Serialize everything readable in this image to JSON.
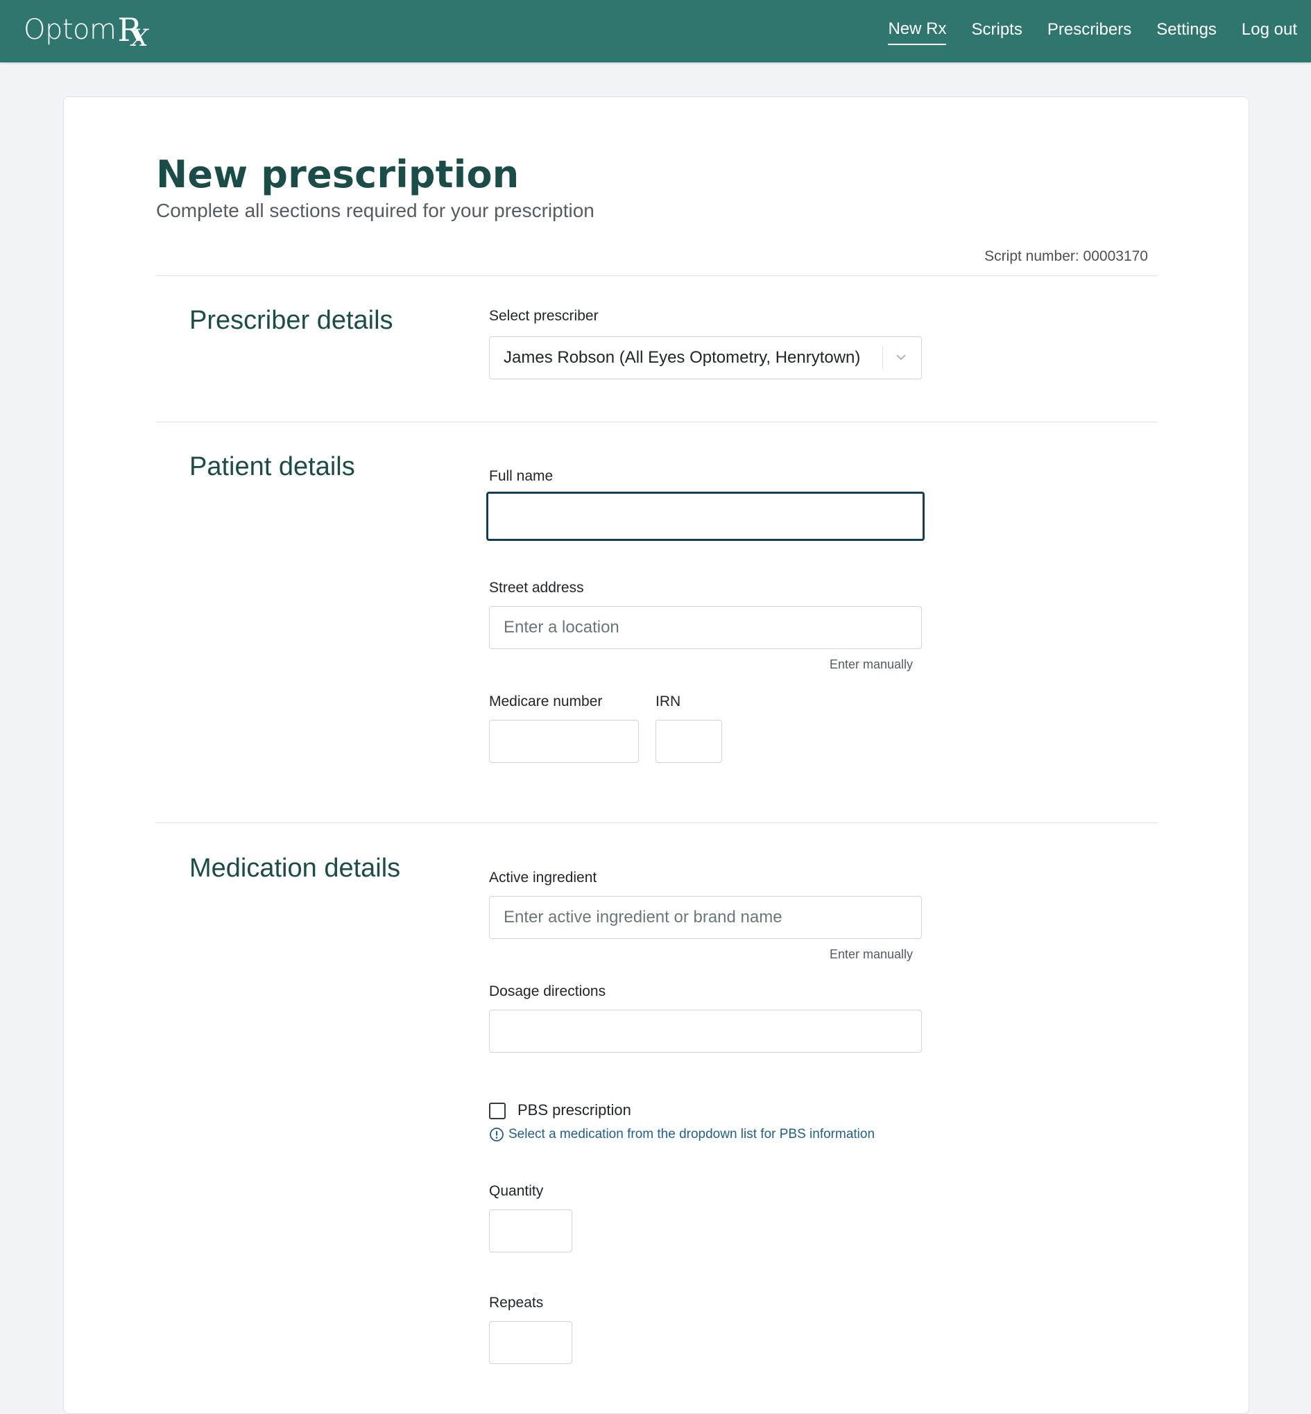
{
  "navbar": {
    "brand": {
      "text": "Optom",
      "r": "R",
      "x": "X"
    },
    "links": [
      {
        "label": "New Rx",
        "active": true
      },
      {
        "label": "Scripts",
        "active": false
      },
      {
        "label": "Prescribers",
        "active": false
      },
      {
        "label": "Settings",
        "active": false
      },
      {
        "label": "Log out",
        "active": false
      }
    ]
  },
  "page": {
    "title": "New prescription",
    "subtitle": "Complete all sections required for your prescription",
    "script_number": "Script number: 00003170"
  },
  "prescriber": {
    "section_title": "Prescriber details",
    "select_label": "Select prescriber",
    "selected_value": "James Robson (All Eyes Optometry, Henrytown)"
  },
  "patient": {
    "section_title": "Patient details",
    "full_name_label": "Full name",
    "full_name_value": "",
    "street_label": "Street address",
    "street_placeholder": "Enter a location",
    "street_manual_link": "Enter manually",
    "medicare_label": "Medicare number",
    "medicare_value": "",
    "irn_label": "IRN",
    "irn_value": ""
  },
  "medication": {
    "section_title": "Medication details",
    "ingredient_label": "Active ingredient",
    "ingredient_placeholder": "Enter active ingredient or brand name",
    "ingredient_manual_link": "Enter manually",
    "dosage_label": "Dosage directions",
    "dosage_value": "",
    "pbs_label": "PBS prescription",
    "pbs_checked": false,
    "pbs_info": "Select a medication from the dropdown list for PBS information",
    "quantity_label": "Quantity",
    "quantity_value": "",
    "repeats_label": "Repeats",
    "repeats_value": ""
  },
  "colors": {
    "navbar": "#2f776e",
    "heading": "#1b4d48",
    "info": "#1f5f8b",
    "focus_border": "#123f57"
  }
}
